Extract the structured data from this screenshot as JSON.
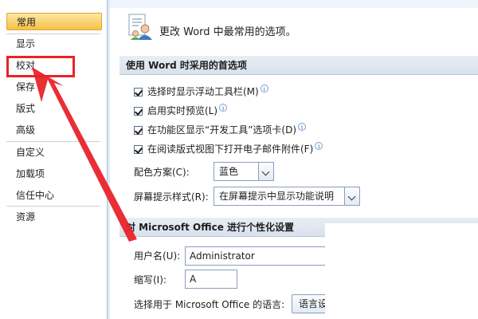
{
  "sidebar": {
    "items": [
      {
        "label": "常用",
        "active": true
      },
      {
        "label": "显示"
      },
      {
        "label": "校对"
      },
      {
        "label": "保存"
      },
      {
        "label": "版式"
      },
      {
        "label": "高级"
      },
      {
        "label": "自定义"
      },
      {
        "label": "加载项"
      },
      {
        "label": "信任中心"
      },
      {
        "label": "资源"
      }
    ]
  },
  "header": {
    "text": "更改 Word 中最常用的选项。",
    "icon": "options-person-icon"
  },
  "section1": {
    "title": "使用 Word 时采用的首选项",
    "options": [
      {
        "label": "选择时显示浮动工具栏(M)",
        "checked": true
      },
      {
        "label": "启用实时预览(L)",
        "checked": true
      },
      {
        "label": "在功能区显示“开发工具”选项卡(D)",
        "checked": true
      },
      {
        "label": "在阅读版式视图下打开电子邮件附件(F)",
        "checked": true
      }
    ],
    "color_scheme": {
      "label": "配色方案(C):",
      "value": "蓝色"
    },
    "screentip": {
      "label": "屏幕提示样式(R):",
      "value": "在屏幕提示中显示功能说明"
    }
  },
  "section2": {
    "title": "对 Microsoft Office 进行个性化设置",
    "username": {
      "label": "用户名(U):",
      "value": "Administrator"
    },
    "initials": {
      "label": "缩写(I):",
      "value": "A"
    },
    "language": {
      "label": "选择用于 Microsoft Office 的语言:",
      "button": "语言设"
    }
  },
  "colors": {
    "accent": "#f7c046",
    "annotation_red": "#e8232a"
  }
}
